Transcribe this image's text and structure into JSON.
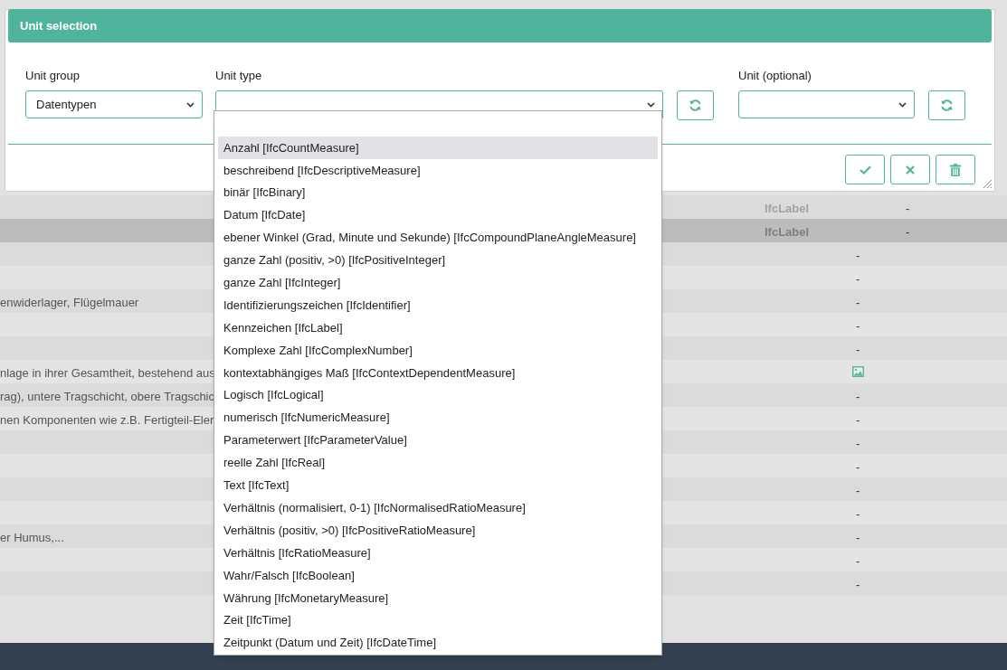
{
  "background": {
    "rows": [
      {
        "kind": "typed",
        "type": "IfcLabel",
        "value": "-",
        "selected": false
      },
      {
        "kind": "typed",
        "type": "IfcLabel",
        "value": "-",
        "selected": true
      },
      {
        "kind": "plain",
        "value": "-",
        "selected": false
      },
      {
        "kind": "plain",
        "value": "-",
        "selected": false
      },
      {
        "kind": "plain",
        "description": "enwiderlager, Flügelmauer",
        "value": "-",
        "selected": false
      },
      {
        "kind": "plain",
        "value": "-",
        "selected": false
      },
      {
        "kind": "plain",
        "value": "-",
        "selected": false
      },
      {
        "kind": "image",
        "description": "nlage in ihrer Gesamtheit, bestehend aus",
        "selected": false
      },
      {
        "kind": "plain",
        "description": "rag), untere Tragschicht, obere Tragschic",
        "value": "-",
        "selected": false
      },
      {
        "kind": "plain",
        "description": "nen Komponenten wie z.B. Fertigteil-Eler",
        "value": "-",
        "selected": false
      },
      {
        "kind": "plain",
        "value": "-",
        "selected": false
      },
      {
        "kind": "plain",
        "value": "-",
        "selected": false
      },
      {
        "kind": "plain",
        "value": "-",
        "selected": false
      },
      {
        "kind": "plain",
        "value": "-",
        "selected": false
      },
      {
        "kind": "plain",
        "description": "er Humus,...",
        "value": "-",
        "selected": false
      },
      {
        "kind": "plain",
        "value": "-",
        "selected": false
      },
      {
        "kind": "plain",
        "value": "-",
        "selected": false
      }
    ]
  },
  "dialog": {
    "title": "Unit selection",
    "fields": [
      {
        "label": "Unit group",
        "value": "Datentypen"
      },
      {
        "label": "Unit type",
        "refresh": true,
        "expanded": true
      },
      {
        "label": "Unit (optional)",
        "refresh": true,
        "expanded": false
      }
    ],
    "actions": [
      {
        "kind": "confirm"
      },
      {
        "kind": "cancel"
      },
      {
        "kind": "delete"
      }
    ]
  },
  "dropdown": {
    "items": [
      {
        "label": "Anzahl [IfcCountMeasure]",
        "selected": true
      },
      {
        "label": "beschreibend [IfcDescriptiveMeasure]",
        "selected": false
      },
      {
        "label": "binär [IfcBinary]",
        "selected": false
      },
      {
        "label": "Datum [IfcDate]",
        "selected": false
      },
      {
        "label": "ebener Winkel (Grad, Minute und Sekunde) [IfcCompoundPlaneAngleMeasure]",
        "selected": false
      },
      {
        "label": "ganze Zahl (positiv, >0) [IfcPositiveInteger]",
        "selected": false
      },
      {
        "label": "ganze Zahl [IfcInteger]",
        "selected": false
      },
      {
        "label": "Identifizierungszeichen [IfcIdentifier]",
        "selected": false
      },
      {
        "label": "Kennzeichen [IfcLabel]",
        "selected": false
      },
      {
        "label": "Komplexe Zahl [IfcComplexNumber]",
        "selected": false
      },
      {
        "label": "kontextabhängiges Maß [IfcContextDependentMeasure]",
        "selected": false
      },
      {
        "label": "Logisch [IfcLogical]",
        "selected": false
      },
      {
        "label": "numerisch [IfcNumericMeasure]",
        "selected": false
      },
      {
        "label": "Parameterwert [IfcParameterValue]",
        "selected": false
      },
      {
        "label": "reelle Zahl [IfcReal]",
        "selected": false
      },
      {
        "label": "Text [IfcText]",
        "selected": false
      },
      {
        "label": "Verhältnis (normalisiert, 0-1) [IfcNormalisedRatioMeasure]",
        "selected": false
      },
      {
        "label": "Verhältnis (positiv, >0) [IfcPositiveRatioMeasure]",
        "selected": false
      },
      {
        "label": "Verhältnis [IfcRatioMeasure]",
        "selected": false
      },
      {
        "label": "Wahr/Falsch [IfcBoolean]",
        "selected": false
      },
      {
        "label": "Währung [IfcMonetaryMeasure]",
        "selected": false
      },
      {
        "label": "Zeit [IfcTime]",
        "selected": false
      },
      {
        "label": "Zeitpunkt (Datum und Zeit) [IfcDateTime]",
        "selected": false
      }
    ]
  }
}
